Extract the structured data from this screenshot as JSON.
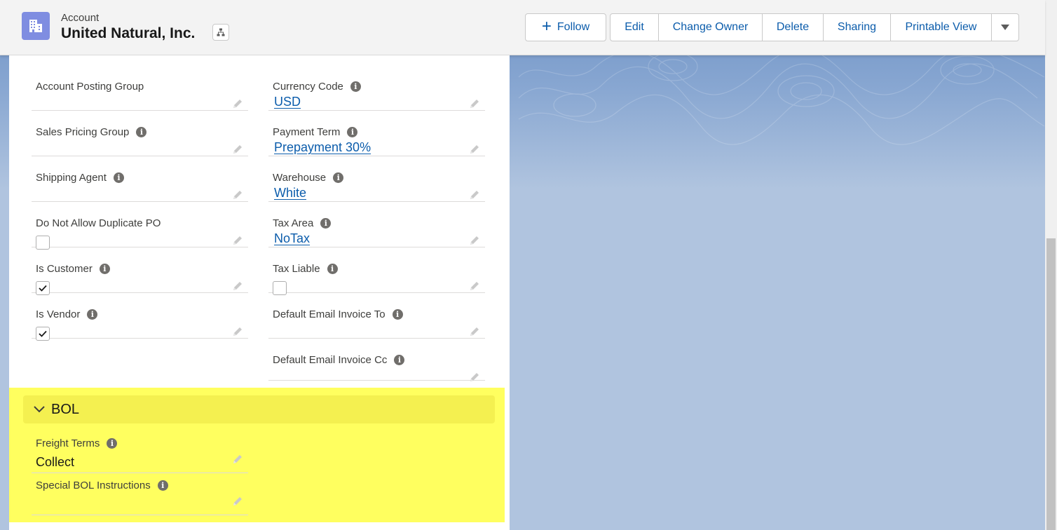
{
  "header": {
    "object_type": "Account",
    "record_name": "United Natural, Inc.",
    "follow_label": "Follow",
    "actions": [
      "Edit",
      "Change Owner",
      "Delete",
      "Sharing",
      "Printable View"
    ]
  },
  "left_column": [
    {
      "label": "Account Posting Group",
      "info": false,
      "type": "text",
      "value": ""
    },
    {
      "label": "Sales Pricing Group",
      "info": true,
      "type": "text",
      "value": ""
    },
    {
      "label": "Shipping Agent",
      "info": true,
      "type": "text",
      "value": ""
    },
    {
      "label": "Do Not Allow Duplicate PO",
      "info": false,
      "type": "checkbox",
      "checked": false
    },
    {
      "label": "Is Customer",
      "info": true,
      "type": "checkbox",
      "checked": true
    },
    {
      "label": "Is Vendor",
      "info": true,
      "type": "checkbox",
      "checked": true
    }
  ],
  "right_column": [
    {
      "label": "Currency Code",
      "info": true,
      "type": "link",
      "value": "USD"
    },
    {
      "label": "Payment Term",
      "info": true,
      "type": "link",
      "value": "Prepayment 30%"
    },
    {
      "label": "Warehouse",
      "info": true,
      "type": "link",
      "value": "White"
    },
    {
      "label": "Tax Area",
      "info": true,
      "type": "link",
      "value": "NoTax"
    },
    {
      "label": "Tax Liable",
      "info": true,
      "type": "checkbox",
      "checked": false
    },
    {
      "label": "Default Email Invoice To",
      "info": true,
      "type": "text",
      "value": ""
    },
    {
      "label": "Default Email Invoice Cc",
      "info": true,
      "type": "text",
      "value": ""
    }
  ],
  "bol_section": {
    "title": "BOL",
    "fields": [
      {
        "label": "Freight Terms",
        "info": true,
        "type": "text",
        "value": "Collect"
      },
      {
        "label": "Special BOL Instructions",
        "info": true,
        "type": "text",
        "value": ""
      }
    ]
  },
  "colors": {
    "brand_blue": "#0b5cab",
    "highlight_yellow": "#ffff5f",
    "account_icon": "#7f8de1"
  }
}
